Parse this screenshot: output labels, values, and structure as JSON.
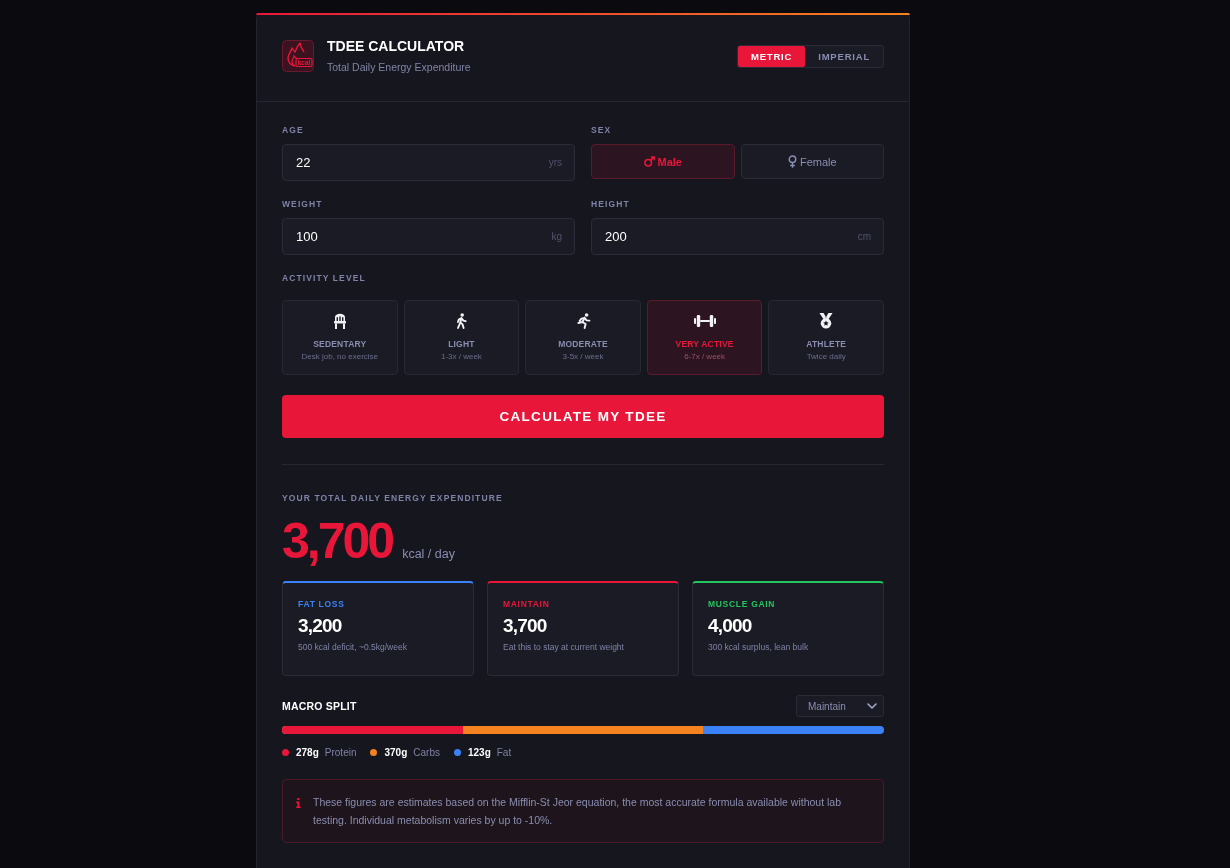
{
  "header": {
    "logo_text": "kcal",
    "title": "TDEE CALCULATOR",
    "subtitle": "Total Daily Energy Expenditure",
    "units": [
      {
        "label": "METRIC",
        "selected": true
      },
      {
        "label": "IMPERIAL",
        "selected": false
      }
    ]
  },
  "form": {
    "age": {
      "label": "AGE",
      "value": "22",
      "unit": "yrs"
    },
    "sex": {
      "label": "SEX",
      "options": [
        {
          "label": "Male",
          "selected": true
        },
        {
          "label": "Female",
          "selected": false
        }
      ]
    },
    "weight": {
      "label": "WEIGHT",
      "value": "100",
      "unit": "kg"
    },
    "height": {
      "label": "HEIGHT",
      "value": "200",
      "unit": "cm"
    },
    "activity": {
      "label": "ACTIVITY LEVEL",
      "options": [
        {
          "name": "SEDENTARY",
          "detail": "Desk job, no exercise",
          "selected": false
        },
        {
          "name": "LIGHT",
          "detail": "1-3x / week",
          "selected": false
        },
        {
          "name": "MODERATE",
          "detail": "3-5x / week",
          "selected": false
        },
        {
          "name": "VERY ACTIVE",
          "detail": "6-7x / week",
          "selected": true
        },
        {
          "name": "ATHLETE",
          "detail": "Twice daily",
          "selected": false
        }
      ]
    },
    "calculate_button": "CALCULATE MY TDEE"
  },
  "result": {
    "label": "YOUR TOTAL DAILY ENERGY EXPENDITURE",
    "value": "3,700",
    "unit": "kcal / day",
    "goals": [
      {
        "label": "FAT LOSS",
        "value": "3,200",
        "detail": "500 kcal deficit, ~0.5kg/week",
        "color": "#3b82f6"
      },
      {
        "label": "MAINTAIN",
        "value": "3,700",
        "detail": "Eat this to stay at current weight",
        "color": "#e8173a"
      },
      {
        "label": "MUSCLE GAIN",
        "value": "4,000",
        "detail": "300 kcal surplus, lean bulk",
        "color": "#22c55e"
      }
    ]
  },
  "macros": {
    "title": "MACRO SPLIT",
    "select_value": "Maintain",
    "split_bar": [
      {
        "color": "#e8173a",
        "level": 0.3
      },
      {
        "color": "#f5821f",
        "level": 0.7
      },
      {
        "color": "#3b82f6",
        "level": 1
      }
    ],
    "legend": [
      {
        "amount": "278g",
        "name": "Protein",
        "color": "#e8173a"
      },
      {
        "amount": "370g",
        "name": "Carbs",
        "color": "#f5821f"
      },
      {
        "amount": "123g",
        "name": "Fat",
        "color": "#3b82f6"
      }
    ]
  },
  "note": {
    "text": "These figures are estimates based on the Mifflin-St Jeor equation, the most accurate formula available without lab testing. Individual metabolism varies by up to -10%."
  }
}
